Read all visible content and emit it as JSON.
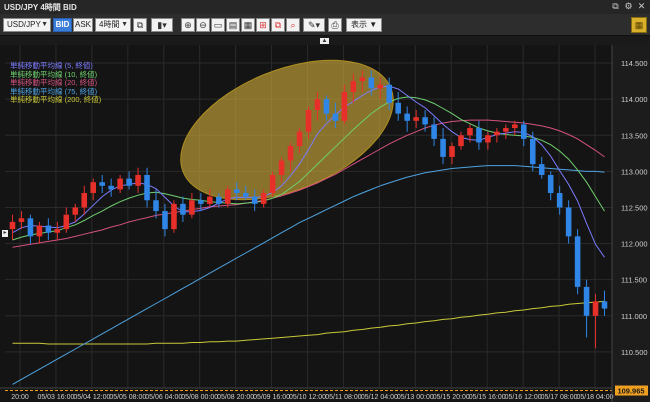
{
  "window": {
    "title": "USD/JPY 4時間 BID"
  },
  "toolbar": {
    "pair": "USD/JPY",
    "bid_label": "BID",
    "ask_label": "ASK",
    "timeframe": "4時間",
    "display_label": "表示"
  },
  "legend": [
    {
      "label": "単純移動平均線 (5, 終値)",
      "color": "#7b7bff"
    },
    {
      "label": "単純移動平均線 (10, 終値)",
      "color": "#6fd06f"
    },
    {
      "label": "単純移動平均線 (20, 終値)",
      "color": "#d4527f"
    },
    {
      "label": "単純移動平均線 (75, 終値)",
      "color": "#4fa3e0"
    },
    {
      "label": "単純移動平均線 (200, 終値)",
      "color": "#c9c93a"
    }
  ],
  "colors": {
    "up": "#e8302a",
    "down": "#2f86e6",
    "background": "#141414",
    "grid": "#2a2a2a",
    "current_price": "#f0a020",
    "highlight": "#d7b13a"
  },
  "chart_data": {
    "type": "candlestick",
    "ylim": [
      110.0,
      114.75
    ],
    "yticks": [
      "114.500",
      "114.000",
      "113.500",
      "113.000",
      "112.500",
      "112.000",
      "111.500",
      "111.000",
      "110.500"
    ],
    "xticks": [
      "20:00",
      "05/03 16:00",
      "05/04 12:00",
      "05/05 08:00",
      "05/06 04:00",
      "05/08 00:00",
      "05/08 20:00",
      "05/09 16:00",
      "05/10 12:00",
      "05/11 08:00",
      "05/12 04:00",
      "05/13 00:00",
      "05/15 20:00",
      "05/15 16:00",
      "05/16 12:00",
      "05/17 08:00",
      "05/18 04:00"
    ],
    "current_price": "109.965",
    "current_price_value": 109.965,
    "candles": [
      [
        112.2,
        112.4,
        112.05,
        112.3
      ],
      [
        112.3,
        112.45,
        112.2,
        112.35
      ],
      [
        112.35,
        112.4,
        112.0,
        112.1
      ],
      [
        112.1,
        112.3,
        112.0,
        112.25
      ],
      [
        112.25,
        112.35,
        112.05,
        112.15
      ],
      [
        112.15,
        112.3,
        112.05,
        112.2
      ],
      [
        112.2,
        112.5,
        112.15,
        112.4
      ],
      [
        112.4,
        112.55,
        112.3,
        112.5
      ],
      [
        112.5,
        112.8,
        112.4,
        112.7
      ],
      [
        112.7,
        112.9,
        112.6,
        112.85
      ],
      [
        112.85,
        112.95,
        112.7,
        112.8
      ],
      [
        112.8,
        112.9,
        112.65,
        112.75
      ],
      [
        112.75,
        112.95,
        112.7,
        112.9
      ],
      [
        112.9,
        113.0,
        112.75,
        112.8
      ],
      [
        112.8,
        113.05,
        112.7,
        112.95
      ],
      [
        112.95,
        113.05,
        112.5,
        112.6
      ],
      [
        112.6,
        112.75,
        112.35,
        112.45
      ],
      [
        112.45,
        112.55,
        112.1,
        112.2
      ],
      [
        112.2,
        112.6,
        112.15,
        112.55
      ],
      [
        112.55,
        112.65,
        112.3,
        112.4
      ],
      [
        112.4,
        112.7,
        112.35,
        112.6
      ],
      [
        112.6,
        112.7,
        112.45,
        112.55
      ],
      [
        112.55,
        112.75,
        112.5,
        112.65
      ],
      [
        112.65,
        112.7,
        112.5,
        112.55
      ],
      [
        112.55,
        112.8,
        112.5,
        112.75
      ],
      [
        112.75,
        112.85,
        112.6,
        112.7
      ],
      [
        112.7,
        112.8,
        112.6,
        112.65
      ],
      [
        112.65,
        112.75,
        112.45,
        112.55
      ],
      [
        112.55,
        112.75,
        112.5,
        112.7
      ],
      [
        112.7,
        113.0,
        112.65,
        112.95
      ],
      [
        112.95,
        113.2,
        112.85,
        113.15
      ],
      [
        113.15,
        113.4,
        113.0,
        113.35
      ],
      [
        113.35,
        113.6,
        113.25,
        113.55
      ],
      [
        113.55,
        113.9,
        113.45,
        113.85
      ],
      [
        113.85,
        114.1,
        113.7,
        114.0
      ],
      [
        114.0,
        114.05,
        113.7,
        113.8
      ],
      [
        113.8,
        113.95,
        113.6,
        113.7
      ],
      [
        113.7,
        114.2,
        113.65,
        114.1
      ],
      [
        114.1,
        114.35,
        113.95,
        114.25
      ],
      [
        114.25,
        114.4,
        114.1,
        114.3
      ],
      [
        114.3,
        114.4,
        114.05,
        114.15
      ],
      [
        114.15,
        114.3,
        114.0,
        114.2
      ],
      [
        114.2,
        114.3,
        113.85,
        113.95
      ],
      [
        113.95,
        114.1,
        113.7,
        113.8
      ],
      [
        113.8,
        113.9,
        113.55,
        113.7
      ],
      [
        113.7,
        113.85,
        113.6,
        113.75
      ],
      [
        113.75,
        113.85,
        113.55,
        113.65
      ],
      [
        113.65,
        113.75,
        113.35,
        113.45
      ],
      [
        113.45,
        113.6,
        113.1,
        113.2
      ],
      [
        113.2,
        113.4,
        113.1,
        113.35
      ],
      [
        113.35,
        113.55,
        113.3,
        113.5
      ],
      [
        113.5,
        113.65,
        113.4,
        113.6
      ],
      [
        113.6,
        113.7,
        113.3,
        113.4
      ],
      [
        113.4,
        113.55,
        113.3,
        113.5
      ],
      [
        113.5,
        113.6,
        113.4,
        113.55
      ],
      [
        113.55,
        113.65,
        113.45,
        113.6
      ],
      [
        113.6,
        113.7,
        113.5,
        113.65
      ],
      [
        113.65,
        113.7,
        113.35,
        113.45
      ],
      [
        113.45,
        113.55,
        113.0,
        113.1
      ],
      [
        113.1,
        113.2,
        112.9,
        112.95
      ],
      [
        112.95,
        113.0,
        112.6,
        112.7
      ],
      [
        112.7,
        112.8,
        112.4,
        112.5
      ],
      [
        112.5,
        112.6,
        112.0,
        112.1
      ],
      [
        112.1,
        112.2,
        111.3,
        111.4
      ],
      [
        111.4,
        111.5,
        110.7,
        111.0
      ],
      [
        111.0,
        111.3,
        110.55,
        111.2
      ],
      [
        111.2,
        111.35,
        111.0,
        111.1
      ]
    ],
    "sma5": [
      112.15,
      112.22,
      112.25,
      112.24,
      112.23,
      112.22,
      112.25,
      112.3,
      112.41,
      112.53,
      112.65,
      112.74,
      112.8,
      112.82,
      112.84,
      112.82,
      112.76,
      112.64,
      112.52,
      112.44,
      112.44,
      112.46,
      112.5,
      112.56,
      112.62,
      112.64,
      112.64,
      112.64,
      112.65,
      112.71,
      112.8,
      112.94,
      113.1,
      113.3,
      113.52,
      113.66,
      113.78,
      113.89,
      113.97,
      114.05,
      114.12,
      114.17,
      114.18,
      114.14,
      114.05,
      113.96,
      113.88,
      113.77,
      113.65,
      113.55,
      113.47,
      113.44,
      113.43,
      113.47,
      113.51,
      113.53,
      113.55,
      113.54,
      113.48,
      113.37,
      113.21,
      113.01,
      112.82,
      112.59,
      112.28,
      111.99,
      111.81
    ],
    "sma10": [
      112.05,
      112.09,
      112.12,
      112.14,
      112.16,
      112.18,
      112.22,
      112.26,
      112.32,
      112.39,
      112.45,
      112.52,
      112.58,
      112.63,
      112.67,
      112.7,
      112.71,
      112.69,
      112.66,
      112.63,
      112.61,
      112.6,
      112.58,
      112.57,
      112.56,
      112.55,
      112.56,
      112.57,
      112.59,
      112.63,
      112.68,
      112.77,
      112.86,
      112.98,
      113.1,
      113.22,
      113.34,
      113.46,
      113.58,
      113.69,
      113.8,
      113.89,
      113.96,
      114.01,
      114.03,
      114.02,
      113.99,
      113.94,
      113.87,
      113.8,
      113.72,
      113.66,
      113.6,
      113.56,
      113.53,
      113.51,
      113.5,
      113.49,
      113.47,
      113.43,
      113.37,
      113.28,
      113.17,
      113.02,
      112.85,
      112.65,
      112.45
    ],
    "sma20": [
      111.95,
      111.97,
      111.99,
      112.01,
      112.03,
      112.05,
      112.07,
      112.1,
      112.13,
      112.16,
      112.19,
      112.23,
      112.26,
      112.3,
      112.33,
      112.36,
      112.39,
      112.41,
      112.43,
      112.45,
      112.47,
      112.49,
      112.51,
      112.52,
      112.53,
      112.54,
      112.56,
      112.58,
      112.6,
      112.63,
      112.66,
      112.7,
      112.74,
      112.79,
      112.84,
      112.9,
      112.96,
      113.03,
      113.1,
      113.17,
      113.24,
      113.31,
      113.38,
      113.44,
      113.5,
      113.55,
      113.6,
      113.64,
      113.67,
      113.69,
      113.7,
      113.71,
      113.71,
      113.71,
      113.7,
      113.69,
      113.68,
      113.67,
      113.65,
      113.63,
      113.6,
      113.56,
      113.51,
      113.45,
      113.37,
      113.29,
      113.2
    ],
    "sma75": [
      110.05,
      110.12,
      110.19,
      110.26,
      110.33,
      110.4,
      110.47,
      110.54,
      110.61,
      110.68,
      110.75,
      110.82,
      110.89,
      110.96,
      111.03,
      111.1,
      111.17,
      111.24,
      111.31,
      111.38,
      111.45,
      111.52,
      111.59,
      111.66,
      111.73,
      111.8,
      111.87,
      111.94,
      112.01,
      112.08,
      112.15,
      112.22,
      112.29,
      112.35,
      112.41,
      112.47,
      112.53,
      112.59,
      112.65,
      112.7,
      112.75,
      112.8,
      112.84,
      112.88,
      112.92,
      112.95,
      112.98,
      113.0,
      113.02,
      113.04,
      113.05,
      113.06,
      113.07,
      113.08,
      113.08,
      113.08,
      113.08,
      113.07,
      113.06,
      113.05,
      113.04,
      113.03,
      113.02,
      113.01,
      113.0,
      113.0,
      112.99
    ],
    "sma200": [
      110.62,
      110.62,
      110.62,
      110.62,
      110.61,
      110.61,
      110.61,
      110.61,
      110.61,
      110.61,
      110.61,
      110.61,
      110.61,
      110.61,
      110.61,
      110.61,
      110.62,
      110.62,
      110.62,
      110.62,
      110.63,
      110.63,
      110.64,
      110.64,
      110.65,
      110.65,
      110.66,
      110.67,
      110.68,
      110.69,
      110.7,
      110.71,
      110.72,
      110.73,
      110.74,
      110.76,
      110.77,
      110.78,
      110.8,
      110.81,
      110.83,
      110.84,
      110.86,
      110.87,
      110.89,
      110.9,
      110.92,
      110.93,
      110.95,
      110.96,
      110.98,
      110.99,
      111.01,
      111.02,
      111.04,
      111.05,
      111.07,
      111.08,
      111.1,
      111.11,
      111.13,
      111.14,
      111.16,
      111.17,
      111.18,
      111.19,
      111.2
    ]
  }
}
